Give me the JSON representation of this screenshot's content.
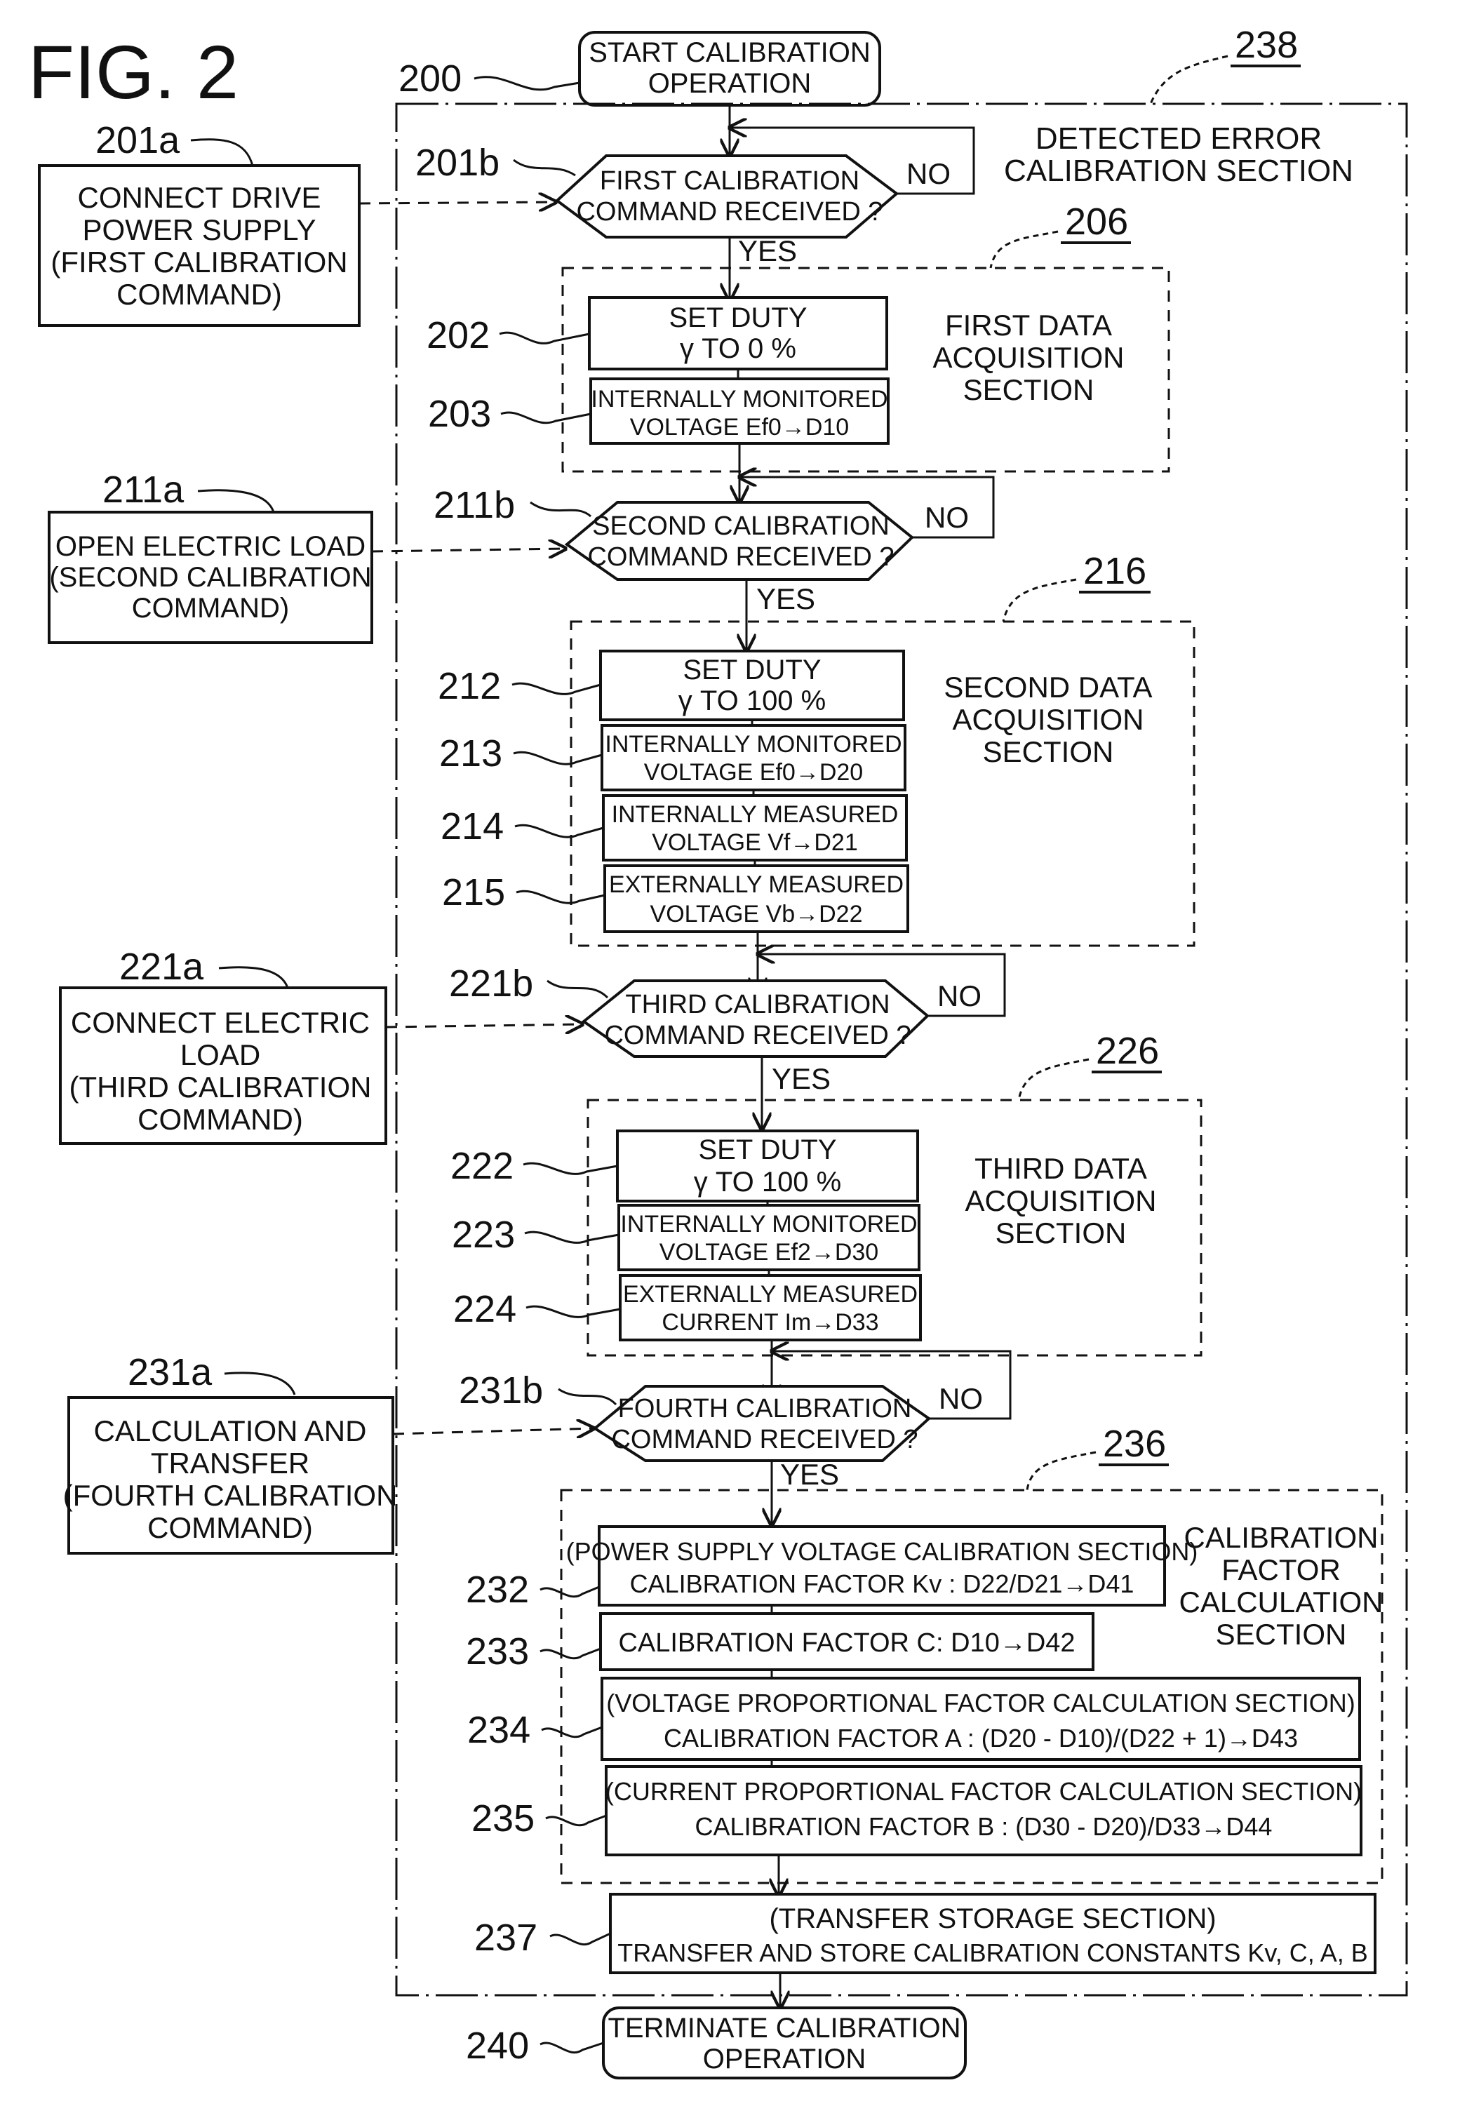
{
  "figure": {
    "title": "FIG. 2"
  },
  "start": {
    "ref": "200",
    "lines": [
      "START CALIBRATION",
      "OPERATION"
    ]
  },
  "end": {
    "ref": "240",
    "lines": [
      "TERMINATE CALIBRATION",
      "OPERATION"
    ]
  },
  "outer_section": {
    "ref": "238",
    "lines": [
      "DETECTED ERROR",
      "CALIBRATION SECTION"
    ]
  },
  "branch_labels": {
    "yes": "YES",
    "no": "NO"
  },
  "commands": [
    {
      "ref": "201a",
      "lines": [
        "CONNECT DRIVE",
        "POWER SUPPLY",
        "(FIRST CALIBRATION",
        "COMMAND)"
      ]
    },
    {
      "ref": "211a",
      "lines": [
        "OPEN ELECTRIC LOAD",
        "(SECOND CALIBRATION",
        "COMMAND)"
      ]
    },
    {
      "ref": "221a",
      "lines": [
        "CONNECT ELECTRIC",
        "LOAD",
        "(THIRD CALIBRATION",
        "COMMAND)"
      ]
    },
    {
      "ref": "231a",
      "lines": [
        "CALCULATION AND",
        "TRANSFER",
        "(FOURTH CALIBRATION",
        "COMMAND)"
      ]
    }
  ],
  "decisions": [
    {
      "ref": "201b",
      "lines": [
        "FIRST CALIBRATION",
        "COMMAND RECEIVED ?"
      ]
    },
    {
      "ref": "211b",
      "lines": [
        "SECOND CALIBRATION",
        "COMMAND RECEIVED ?"
      ]
    },
    {
      "ref": "221b",
      "lines": [
        "THIRD CALIBRATION",
        "COMMAND RECEIVED ?"
      ]
    },
    {
      "ref": "231b",
      "lines": [
        "FOURTH CALIBRATION",
        "COMMAND RECEIVED ?"
      ]
    }
  ],
  "sections": [
    {
      "ref": "206",
      "lines": [
        "FIRST DATA",
        "ACQUISITION",
        "SECTION"
      ],
      "steps": [
        {
          "ref": "202",
          "lines": [
            "SET DUTY",
            "γ  TO 0 %"
          ]
        },
        {
          "ref": "203",
          "lines": [
            "INTERNALLY MONITORED",
            "VOLTAGE Ef0→D10"
          ]
        }
      ]
    },
    {
      "ref": "216",
      "lines": [
        "SECOND DATA",
        "ACQUISITION",
        "SECTION"
      ],
      "steps": [
        {
          "ref": "212",
          "lines": [
            "SET DUTY",
            "γ  TO 100 %"
          ]
        },
        {
          "ref": "213",
          "lines": [
            "INTERNALLY MONITORED",
            "VOLTAGE Ef0→D20"
          ]
        },
        {
          "ref": "214",
          "lines": [
            "INTERNALLY MEASURED",
            "VOLTAGE Vf→D21"
          ]
        },
        {
          "ref": "215",
          "lines": [
            "EXTERNALLY MEASURED",
            "VOLTAGE Vb→D22"
          ]
        }
      ]
    },
    {
      "ref": "226",
      "lines": [
        "THIRD DATA",
        "ACQUISITION",
        "SECTION"
      ],
      "steps": [
        {
          "ref": "222",
          "lines": [
            "SET DUTY",
            "γ  TO 100 %"
          ]
        },
        {
          "ref": "223",
          "lines": [
            "INTERNALLY MONITORED",
            "VOLTAGE Ef2→D30"
          ]
        },
        {
          "ref": "224",
          "lines": [
            "EXTERNALLY MEASURED",
            "CURRENT Im→D33"
          ]
        }
      ]
    },
    {
      "ref": "236",
      "lines": [
        "CALIBRATION",
        "FACTOR",
        "CALCULATION",
        "SECTION"
      ],
      "steps": [
        {
          "ref": "232",
          "lines": [
            "(POWER SUPPLY VOLTAGE CALIBRATION SECTION)",
            "CALIBRATION FACTOR Kv : D22/D21→D41"
          ]
        },
        {
          "ref": "233",
          "lines": [
            "CALIBRATION FACTOR C: D10→D42"
          ]
        },
        {
          "ref": "234",
          "lines": [
            "(VOLTAGE PROPORTIONAL FACTOR CALCULATION SECTION)",
            "CALIBRATION FACTOR A : (D20 - D10)/(D22 + 1)→D43"
          ]
        },
        {
          "ref": "235",
          "lines": [
            "(CURRENT PROPORTIONAL FACTOR CALCULATION SECTION)",
            "CALIBRATION FACTOR B : (D30 - D20)/D33→D44"
          ]
        }
      ]
    }
  ],
  "transfer": {
    "ref": "237",
    "lines": [
      "(TRANSFER STORAGE SECTION)",
      "TRANSFER AND STORE CALIBRATION CONSTANTS Kv, C, A, B"
    ]
  }
}
